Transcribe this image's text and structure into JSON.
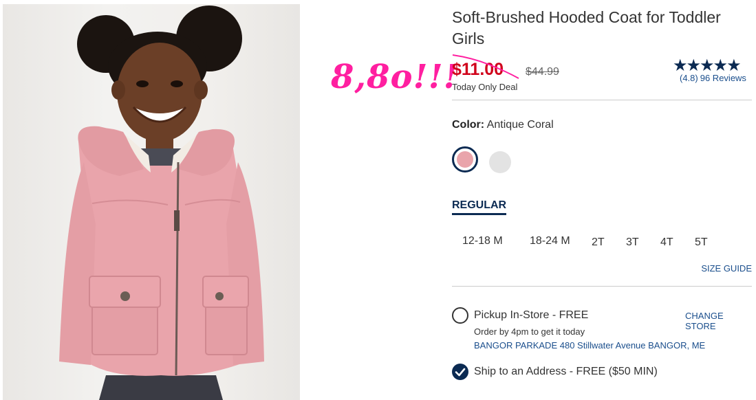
{
  "product": {
    "title": "Soft-Brushed Hooded Coat for Toddler Girls",
    "sale_price": "$11.00",
    "original_price": "$44.99",
    "deal_label": "Today Only Deal",
    "rating": {
      "stars": "★★★★★",
      "score_text": "(4.8)",
      "reviews_text": "96 Reviews"
    },
    "handwritten_note": "8,8o!!!",
    "color": {
      "label": "Color:",
      "value": "Antique Coral",
      "swatches": [
        "#e9a4ab",
        "#e3e3e3"
      ]
    },
    "fit_tab": "REGULAR",
    "sizes": [
      "12-18 M",
      "18-24 M",
      "2T",
      "3T",
      "4T",
      "5T"
    ],
    "size_guide": "SIZE GUIDE"
  },
  "fulfillment": {
    "pickup": {
      "label": "Pickup In-Store - FREE",
      "note": "Order by 4pm to get it today",
      "store": "BANGOR PARKADE 480 Stillwater Avenue  BANGOR, ME",
      "change_store": "CHANGE STORE"
    },
    "ship": {
      "label": "Ship to an Address - FREE ($50 MIN)"
    }
  },
  "colors": {
    "sale_red": "#d0021b",
    "navy": "#0b2a52",
    "link_blue": "#1a4e8c",
    "note_pink": "#ff1fa0"
  }
}
